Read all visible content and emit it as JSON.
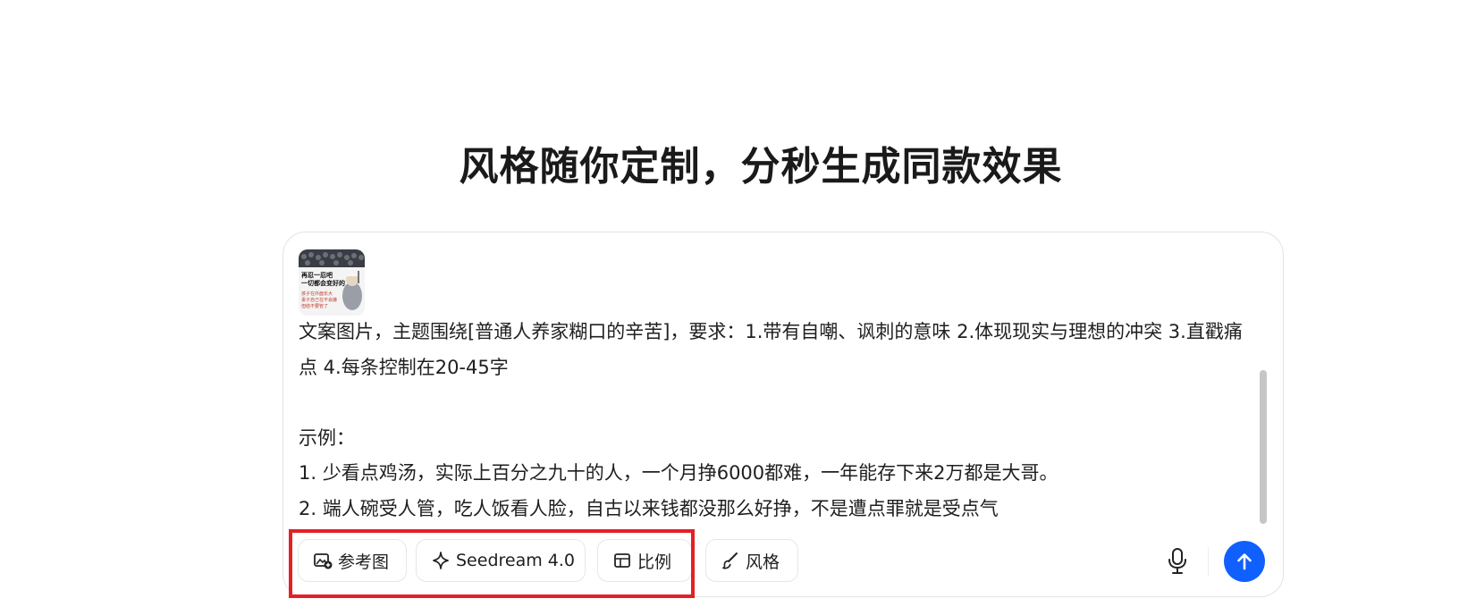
{
  "headline": "风格随你定制，分秒生成同款效果",
  "composer": {
    "reference_thumbnail": {
      "line1": "再忍一忍吧",
      "line2": "一切都会变好的",
      "line3": "孩子在外面长大",
      "line4": "妻子自己在不会嫌",
      "line5": "但结不要管了"
    },
    "prompt_text": "文案图片，主题围绕[普通人养家糊口的辛苦]，要求：1.带有自嘲、讽刺的意味 2.体现现实与理想的冲突 3.直戳痛点 4.每条控制在20-45字\n\n示例：\n1. 少看点鸡汤，实际上百分之九十的人，一个月挣6000都难，一年能存下来2万都是大哥。\n2. 端人碗受人管，吃人饭看人脸，自古以来钱都没那么好挣，不是遭点罪就是受点气",
    "toolbar": {
      "reference_label": "参考图",
      "model_label": "Seedream 4.0",
      "ratio_label": "比例",
      "style_label": "风格"
    }
  },
  "colors": {
    "accent": "#1060ff",
    "highlight": "#e32026"
  },
  "icons": {
    "reference": "image-add-icon",
    "model": "sparkle-icon",
    "ratio": "aspect-ratio-icon",
    "style": "brush-icon",
    "mic": "microphone-icon",
    "send": "arrow-up-icon"
  }
}
